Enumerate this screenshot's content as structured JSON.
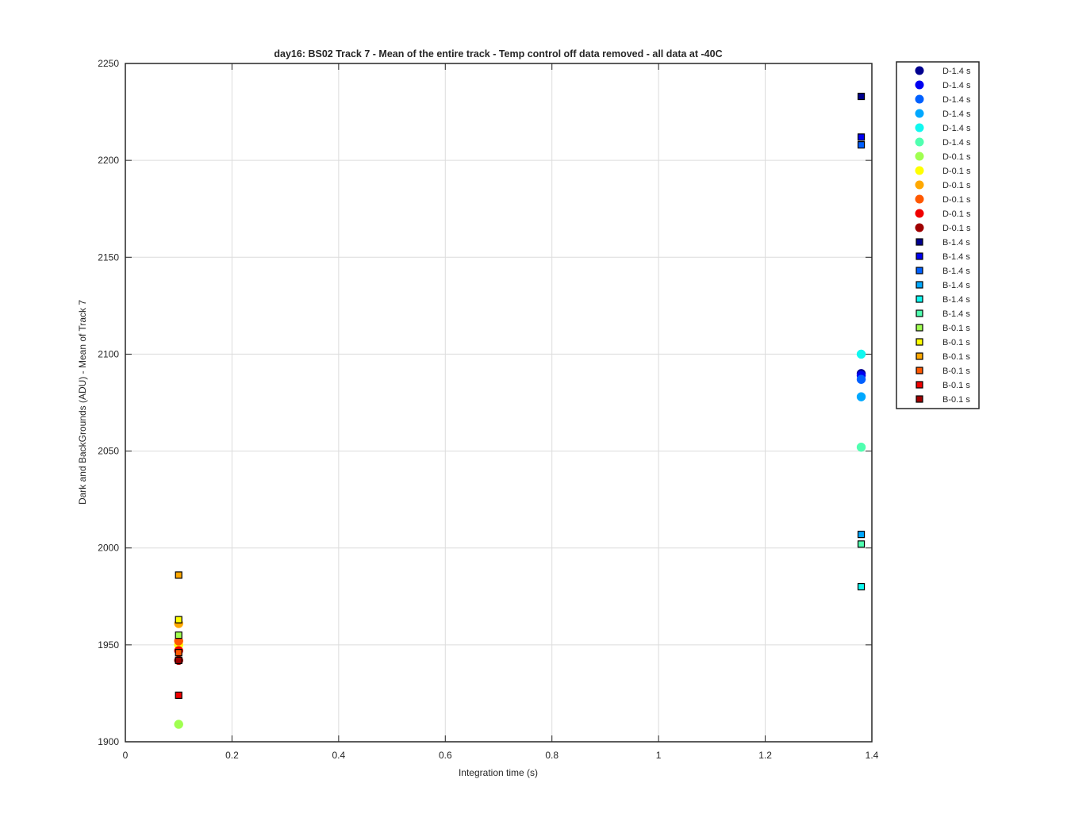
{
  "chart_data": {
    "type": "scatter",
    "title": "day16: BS02  Track 7 - Mean of the entire track - Temp control off data removed - all data at -40C",
    "xlabel": "Integration time (s)",
    "ylabel": "Dark and BackGrounds (ADU) - Mean of Track 7",
    "xlim": [
      0,
      1.4
    ],
    "ylim": [
      1900,
      2250
    ],
    "xticks": [
      0,
      0.2,
      0.4,
      0.6,
      0.8,
      1,
      1.2,
      1.4
    ],
    "yticks": [
      1900,
      1950,
      2000,
      2050,
      2100,
      2150,
      2200,
      2250
    ],
    "grid": true,
    "legend_position": "outside-right",
    "series": [
      {
        "name": "D-1.4 s",
        "marker": "circle",
        "color": "#00008f",
        "x": [
          1.38
        ],
        "y": [
          2090
        ]
      },
      {
        "name": "D-1.4 s",
        "marker": "circle",
        "color": "#0000f0",
        "x": [
          1.38
        ],
        "y": [
          2089
        ]
      },
      {
        "name": "D-1.4 s",
        "marker": "circle",
        "color": "#0060ff",
        "x": [
          1.38
        ],
        "y": [
          2087
        ]
      },
      {
        "name": "D-1.4 s",
        "marker": "circle",
        "color": "#00a8ff",
        "x": [
          1.38
        ],
        "y": [
          2078
        ]
      },
      {
        "name": "D-1.4 s",
        "marker": "circle",
        "color": "#10f8f0",
        "x": [
          1.38
        ],
        "y": [
          2100
        ]
      },
      {
        "name": "D-1.4 s",
        "marker": "circle",
        "color": "#50ffb0",
        "x": [
          1.38
        ],
        "y": [
          2052
        ]
      },
      {
        "name": "D-0.1 s",
        "marker": "circle",
        "color": "#a0ff50",
        "x": [
          0.1
        ],
        "y": [
          1909
        ]
      },
      {
        "name": "D-0.1 s",
        "marker": "circle",
        "color": "#ffff00",
        "x": [
          0.1
        ],
        "y": [
          1950
        ]
      },
      {
        "name": "D-0.1 s",
        "marker": "circle",
        "color": "#ffa800",
        "x": [
          0.1
        ],
        "y": [
          1961
        ]
      },
      {
        "name": "D-0.1 s",
        "marker": "circle",
        "color": "#ff5800",
        "x": [
          0.1
        ],
        "y": [
          1952
        ]
      },
      {
        "name": "D-0.1 s",
        "marker": "circle",
        "color": "#f00000",
        "x": [
          0.1
        ],
        "y": [
          1947
        ]
      },
      {
        "name": "D-0.1 s",
        "marker": "circle",
        "color": "#9f0000",
        "x": [
          0.1
        ],
        "y": [
          1942
        ]
      },
      {
        "name": "B-1.4 s",
        "marker": "square",
        "color": "#00008f",
        "x": [
          1.38
        ],
        "y": [
          2233
        ]
      },
      {
        "name": "B-1.4 s",
        "marker": "square",
        "color": "#0000f0",
        "x": [
          1.38
        ],
        "y": [
          2212
        ]
      },
      {
        "name": "B-1.4 s",
        "marker": "square",
        "color": "#0060ff",
        "x": [
          1.38
        ],
        "y": [
          2208
        ]
      },
      {
        "name": "B-1.4 s",
        "marker": "square",
        "color": "#00a8ff",
        "x": [
          1.38
        ],
        "y": [
          2007
        ]
      },
      {
        "name": "B-1.4 s",
        "marker": "square",
        "color": "#10f8f0",
        "x": [
          1.38
        ],
        "y": [
          1980
        ]
      },
      {
        "name": "B-1.4 s",
        "marker": "square",
        "color": "#50ffb0",
        "x": [
          1.38
        ],
        "y": [
          2002
        ]
      },
      {
        "name": "B-0.1 s",
        "marker": "square",
        "color": "#a0ff50",
        "x": [
          0.1
        ],
        "y": [
          1955
        ]
      },
      {
        "name": "B-0.1 s",
        "marker": "square",
        "color": "#ffff00",
        "x": [
          0.1
        ],
        "y": [
          1963
        ]
      },
      {
        "name": "B-0.1 s",
        "marker": "square",
        "color": "#ffa800",
        "x": [
          0.1
        ],
        "y": [
          1986
        ]
      },
      {
        "name": "B-0.1 s",
        "marker": "square",
        "color": "#ff5800",
        "x": [
          0.1
        ],
        "y": [
          1946
        ]
      },
      {
        "name": "B-0.1 s",
        "marker": "square",
        "color": "#f00000",
        "x": [
          0.1
        ],
        "y": [
          1924
        ]
      },
      {
        "name": "B-0.1 s",
        "marker": "square",
        "color": "#9f0000",
        "x": [
          0.1
        ],
        "y": [
          1942
        ]
      }
    ]
  }
}
